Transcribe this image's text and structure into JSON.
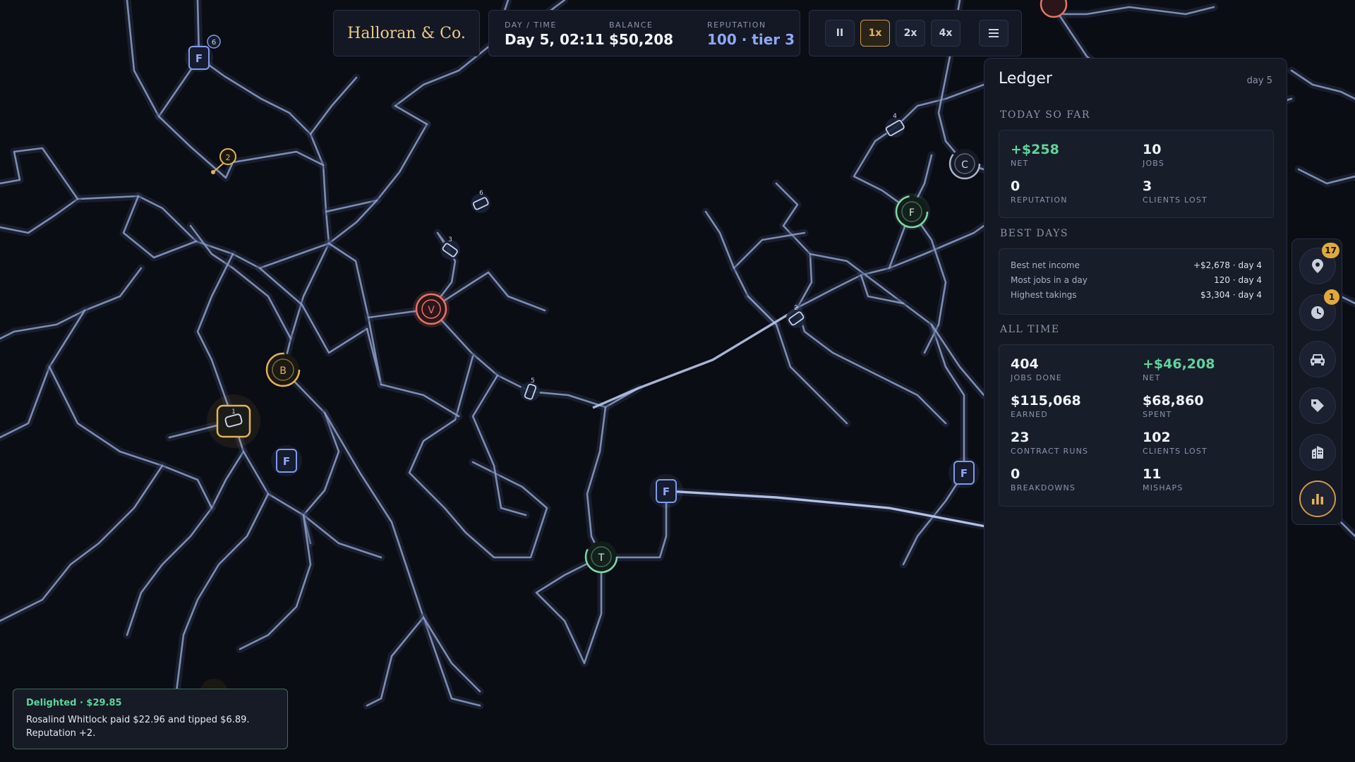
{
  "company": "Halloran & Co.",
  "stats": {
    "daytime_label": "DAY / TIME",
    "daytime_value": "Day 5, 02:11",
    "balance_label": "BALANCE",
    "balance_value": "$50,208",
    "reputation_label": "REPUTATION",
    "reputation_value": "100 · tier 3"
  },
  "speed": {
    "pause_label": "II",
    "x1_label": "1x",
    "x2_label": "2x",
    "x4_label": "4x",
    "active": "1x"
  },
  "ledger": {
    "title": "Ledger",
    "day": "day 5",
    "today_heading": "TODAY SO FAR",
    "today": [
      {
        "value": "+$258",
        "label": "NET"
      },
      {
        "value": "10",
        "label": "JOBS"
      },
      {
        "value": "0",
        "label": "REPUTATION"
      },
      {
        "value": "3",
        "label": "CLIENTS LOST"
      }
    ],
    "best_heading": "BEST DAYS",
    "best": [
      {
        "label": "Best net income",
        "value": "+$2,678 · day 4"
      },
      {
        "label": "Most jobs in a day",
        "value": "120 · day 4"
      },
      {
        "label": "Highest takings",
        "value": "$3,304 · day 4"
      }
    ],
    "alltime_heading": "ALL TIME",
    "alltime": [
      {
        "value": "404",
        "label": "JOBS DONE"
      },
      {
        "value": "+$46,208",
        "label": "NET"
      },
      {
        "value": "$115,068",
        "label": "EARNED"
      },
      {
        "value": "$68,860",
        "label": "SPENT"
      },
      {
        "value": "23",
        "label": "CONTRACT RUNS"
      },
      {
        "value": "102",
        "label": "CLIENTS LOST"
      },
      {
        "value": "0",
        "label": "BREAKDOWNS"
      },
      {
        "value": "11",
        "label": "MISHAPS"
      }
    ]
  },
  "rail": {
    "pins_badge": "17",
    "clock_badge": "1",
    "icons": [
      "map-pin-icon",
      "clock-icon",
      "car-icon",
      "tag-icon",
      "building-icon",
      "bar-chart-icon"
    ],
    "active": "bar-chart-icon"
  },
  "toast": {
    "title": "Delighted · $29.85",
    "body": "Rosalind Whitlock paid $22.96 and tipped $6.89. Reputation +2."
  },
  "map": {
    "markers": {
      "v_main": "V",
      "b": "B",
      "c": "C",
      "f_circle": "F",
      "t": "T",
      "f_depots": [
        "F",
        "F",
        "F",
        "F"
      ],
      "depot_badge": "6",
      "pin_label": "2",
      "vehicle_nums": [
        "6",
        "3",
        "5",
        "1",
        "4",
        "2"
      ]
    },
    "colors": {
      "background": "#0b0d14",
      "road": "#8fa0c8",
      "depot": "#7f9ae8",
      "gold": "#e2b457",
      "red": "#e6736a",
      "green": "#7fd7a8"
    }
  }
}
